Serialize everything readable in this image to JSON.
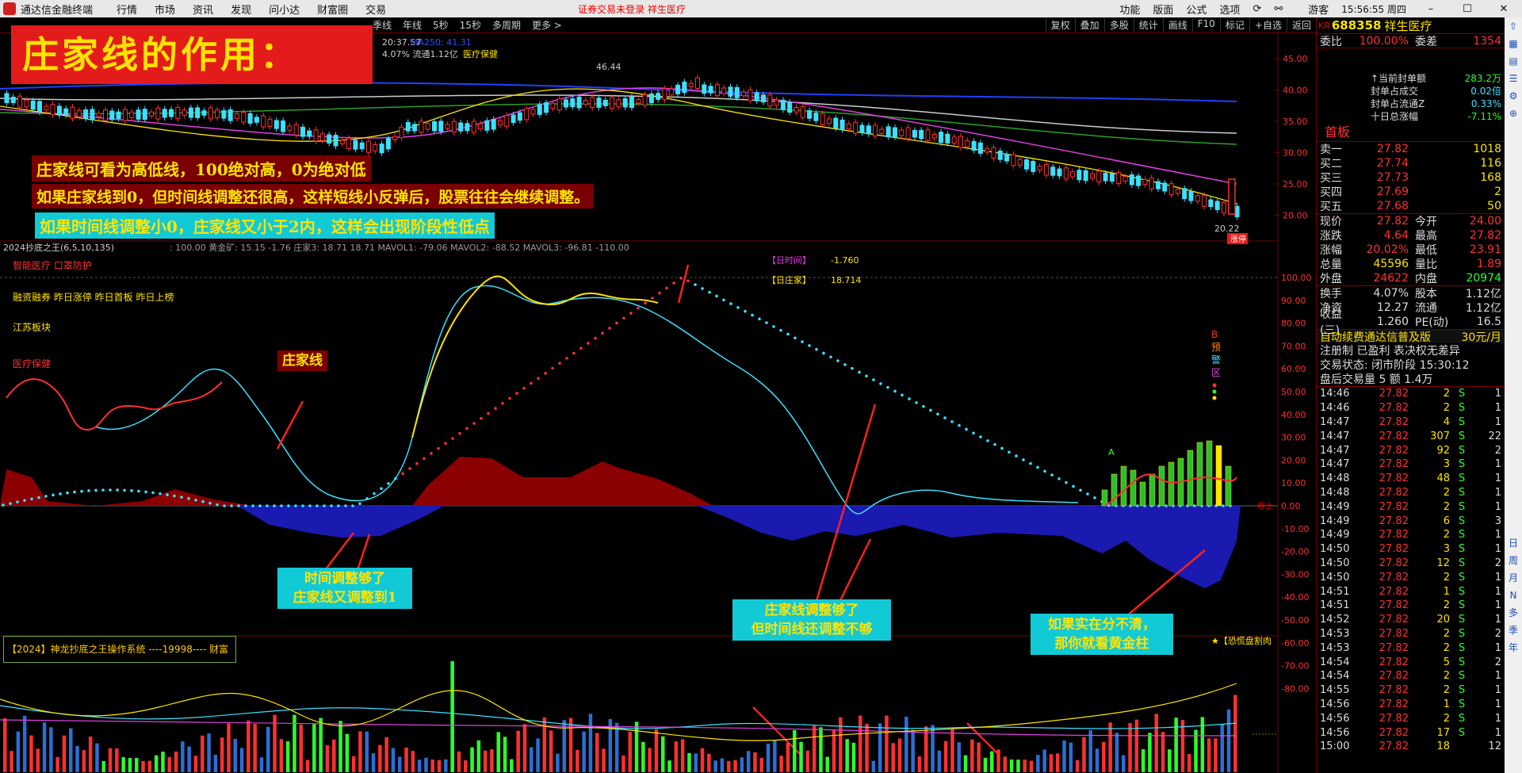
{
  "app": {
    "title": "通达信金融终端",
    "menu": [
      "行情",
      "市场",
      "资讯",
      "发现",
      "问小达",
      "财富圈",
      "交易"
    ],
    "status": "证券交易未登录  祥生医疗",
    "right_menu": [
      "功能",
      "版面",
      "公式",
      "选项"
    ],
    "guest": "游客",
    "clock": "15:56:55 周四"
  },
  "toolbar": {
    "periods": [
      "季线",
      "年线",
      "5秒",
      "15秒",
      "多周期",
      "更多 >"
    ],
    "tools": [
      "复权",
      "叠加",
      "多股",
      "统计",
      "画线",
      "F10",
      "标记",
      "+自选",
      "返回"
    ]
  },
  "price_header": {
    "text1": "20:37.57",
    "ma": "MA250: 41.31",
    "text2": "4.07% 流通1.12亿",
    "sector": "医疗保健",
    "high_label": "46.44",
    "low_label": "20.22",
    "limit_tag": "涨停"
  },
  "price_axis": [
    "45.00",
    "40.00",
    "35.00",
    "30.00",
    "25.00",
    "20.00"
  ],
  "indicator": {
    "header_name": "2024抄底之王(6,5,10,135)",
    "header_vals": ": 100.00  黄金矿: 15.15  -1.76  庄家3: 18.71  18.71  MAVOL1: -79.06  MAVOL2: -88.52  MAVOL3: -96.81  -110.00",
    "tag_time": "【日时间】",
    "val_time": "-1.760",
    "tag_zj": "【日庄家】",
    "val_zj": "18.714",
    "axis": [
      "100.00",
      "90.00",
      "80.00",
      "70.00",
      "60.00",
      "50.00",
      "40.00",
      "30.00",
      "20.00",
      "10.00",
      "0.00",
      "-10.00",
      "-20.00",
      "-30.00",
      "-40.00",
      "-50.00",
      "-60.00",
      "-70.00",
      "-80.00"
    ],
    "zero_label": "零上",
    "alert": [
      "B",
      "预",
      "警",
      "区"
    ],
    "a_label": "A",
    "side_labels": [
      "智能医疗 口罩防护",
      "融资融券 昨日涨停 昨日首板 昨日上榜",
      "江苏板块",
      "医疗保健"
    ],
    "strategy": "【2024】神龙抄底之王操作系统  ----19998---- 财富",
    "fear": "★【恐慌盘割肉"
  },
  "annotations": {
    "headline": "庄家线的作用：",
    "note1": "庄家线可看为高低线，100绝对高，0为绝对低",
    "note2": "如果庄家线到0，但时间线调整还很高，这样短线小反弹后，股票往往会继续调整。",
    "note3": "如果时间线调整小0，庄家线又小于2内，这样会出现阶段性低点",
    "zjx": "庄家线",
    "time_line1": "时间调整够了",
    "time_line2": "庄家线又调整到1",
    "zj_line1": "庄家线调整够了",
    "zj_line2": "但时间线还调整不够",
    "gold_line1": "如果实在分不清，",
    "gold_line2": "那你就看黄金柱"
  },
  "quote": {
    "kr": "KR",
    "code": "688358",
    "name": "祥生医疗",
    "wb_label": "委比",
    "wb_val": "100.00%",
    "wc_label": "委差",
    "wc_val": "1354",
    "first_board": "首板",
    "seal": [
      {
        "k": "↑当前封单额",
        "v": "283.2万"
      },
      {
        "k": "封单占成交",
        "v": "0.02倍"
      },
      {
        "k": "封单占流通Z",
        "v": "0.33%"
      },
      {
        "k": "十日总涨幅",
        "v": "-7.11%"
      }
    ],
    "book": [
      {
        "k": "卖一",
        "p": "27.82",
        "q": "1018"
      },
      {
        "k": "买二",
        "p": "27.74",
        "q": "116"
      },
      {
        "k": "买三",
        "p": "27.73",
        "q": "168"
      },
      {
        "k": "买四",
        "p": "27.69",
        "q": "2"
      },
      {
        "k": "买五",
        "p": "27.68",
        "q": "50"
      }
    ],
    "stats": [
      {
        "k": "现价",
        "v": "27.82",
        "k2": "今开",
        "v2": "24.00"
      },
      {
        "k": "涨跌",
        "v": "4.64",
        "k2": "最高",
        "v2": "27.82"
      },
      {
        "k": "涨幅",
        "v": "20.02%",
        "k2": "最低",
        "v2": "23.91"
      },
      {
        "k": "总量",
        "v": "45596",
        "k2": "量比",
        "v2": "1.89"
      },
      {
        "k": "外盘",
        "v": "24622",
        "k2": "内盘",
        "v2": "20974"
      }
    ],
    "stats2": [
      {
        "k": "换手",
        "v": "4.07%",
        "k2": "股本",
        "v2": "1.12亿"
      },
      {
        "k": "净资",
        "v": "12.27",
        "k2": "流通",
        "v2": "1.12亿"
      },
      {
        "k": "收益(三)",
        "v": "1.260",
        "k2": "PE(动)",
        "v2": "16.5"
      }
    ],
    "promo": "自动续费通达信普及版",
    "price_promo": "30元/月",
    "reg": "注册制 已盈利 表决权无差异",
    "trade_status": "交易状态: 闭市阶段 15:30:12",
    "after": "盘后交易量 5 额 1.4万"
  },
  "ticks": [
    {
      "t": "14:46",
      "p": "27.82",
      "q": "2",
      "s": "S",
      "n": "1"
    },
    {
      "t": "14:46",
      "p": "27.82",
      "q": "2",
      "s": "S",
      "n": "1"
    },
    {
      "t": "14:47",
      "p": "27.82",
      "q": "4",
      "s": "S",
      "n": "1"
    },
    {
      "t": "14:47",
      "p": "27.82",
      "q": "307",
      "s": "S",
      "n": "22"
    },
    {
      "t": "14:47",
      "p": "27.82",
      "q": "92",
      "s": "S",
      "n": "2"
    },
    {
      "t": "14:47",
      "p": "27.82",
      "q": "3",
      "s": "S",
      "n": "1"
    },
    {
      "t": "14:48",
      "p": "27.82",
      "q": "48",
      "s": "S",
      "n": "1"
    },
    {
      "t": "14:48",
      "p": "27.82",
      "q": "2",
      "s": "S",
      "n": "1"
    },
    {
      "t": "14:49",
      "p": "27.82",
      "q": "2",
      "s": "S",
      "n": "1"
    },
    {
      "t": "14:49",
      "p": "27.82",
      "q": "6",
      "s": "S",
      "n": "3"
    },
    {
      "t": "14:49",
      "p": "27.82",
      "q": "2",
      "s": "S",
      "n": "1"
    },
    {
      "t": "14:50",
      "p": "27.82",
      "q": "3",
      "s": "S",
      "n": "1"
    },
    {
      "t": "14:50",
      "p": "27.82",
      "q": "12",
      "s": "S",
      "n": "2"
    },
    {
      "t": "14:50",
      "p": "27.82",
      "q": "2",
      "s": "S",
      "n": "1"
    },
    {
      "t": "14:51",
      "p": "27.82",
      "q": "1",
      "s": "S",
      "n": "1"
    },
    {
      "t": "14:51",
      "p": "27.82",
      "q": "2",
      "s": "S",
      "n": "1"
    },
    {
      "t": "14:52",
      "p": "27.82",
      "q": "20",
      "s": "S",
      "n": "1"
    },
    {
      "t": "14:53",
      "p": "27.82",
      "q": "2",
      "s": "S",
      "n": "2"
    },
    {
      "t": "14:53",
      "p": "27.82",
      "q": "2",
      "s": "S",
      "n": "1"
    },
    {
      "t": "14:54",
      "p": "27.82",
      "q": "5",
      "s": "S",
      "n": "2"
    },
    {
      "t": "14:54",
      "p": "27.82",
      "q": "2",
      "s": "S",
      "n": "1"
    },
    {
      "t": "14:55",
      "p": "27.82",
      "q": "2",
      "s": "S",
      "n": "1"
    },
    {
      "t": "14:56",
      "p": "27.82",
      "q": "1",
      "s": "S",
      "n": "1"
    },
    {
      "t": "14:56",
      "p": "27.82",
      "q": "2",
      "s": "S",
      "n": "1"
    },
    {
      "t": "14:56",
      "p": "27.82",
      "q": "17",
      "s": "S",
      "n": "1"
    },
    {
      "t": "15:00",
      "p": "27.82",
      "q": "18",
      "s": "",
      "n": "12"
    }
  ],
  "side_icons": [
    "日",
    "周",
    "月",
    "N",
    "多",
    "季",
    "年"
  ],
  "colors": {
    "up": "#ff3030",
    "down": "#3ce0ff",
    "accent": "#ffe400",
    "label_bg": "#12c9d6",
    "headline_bg": "#e41b1b"
  }
}
